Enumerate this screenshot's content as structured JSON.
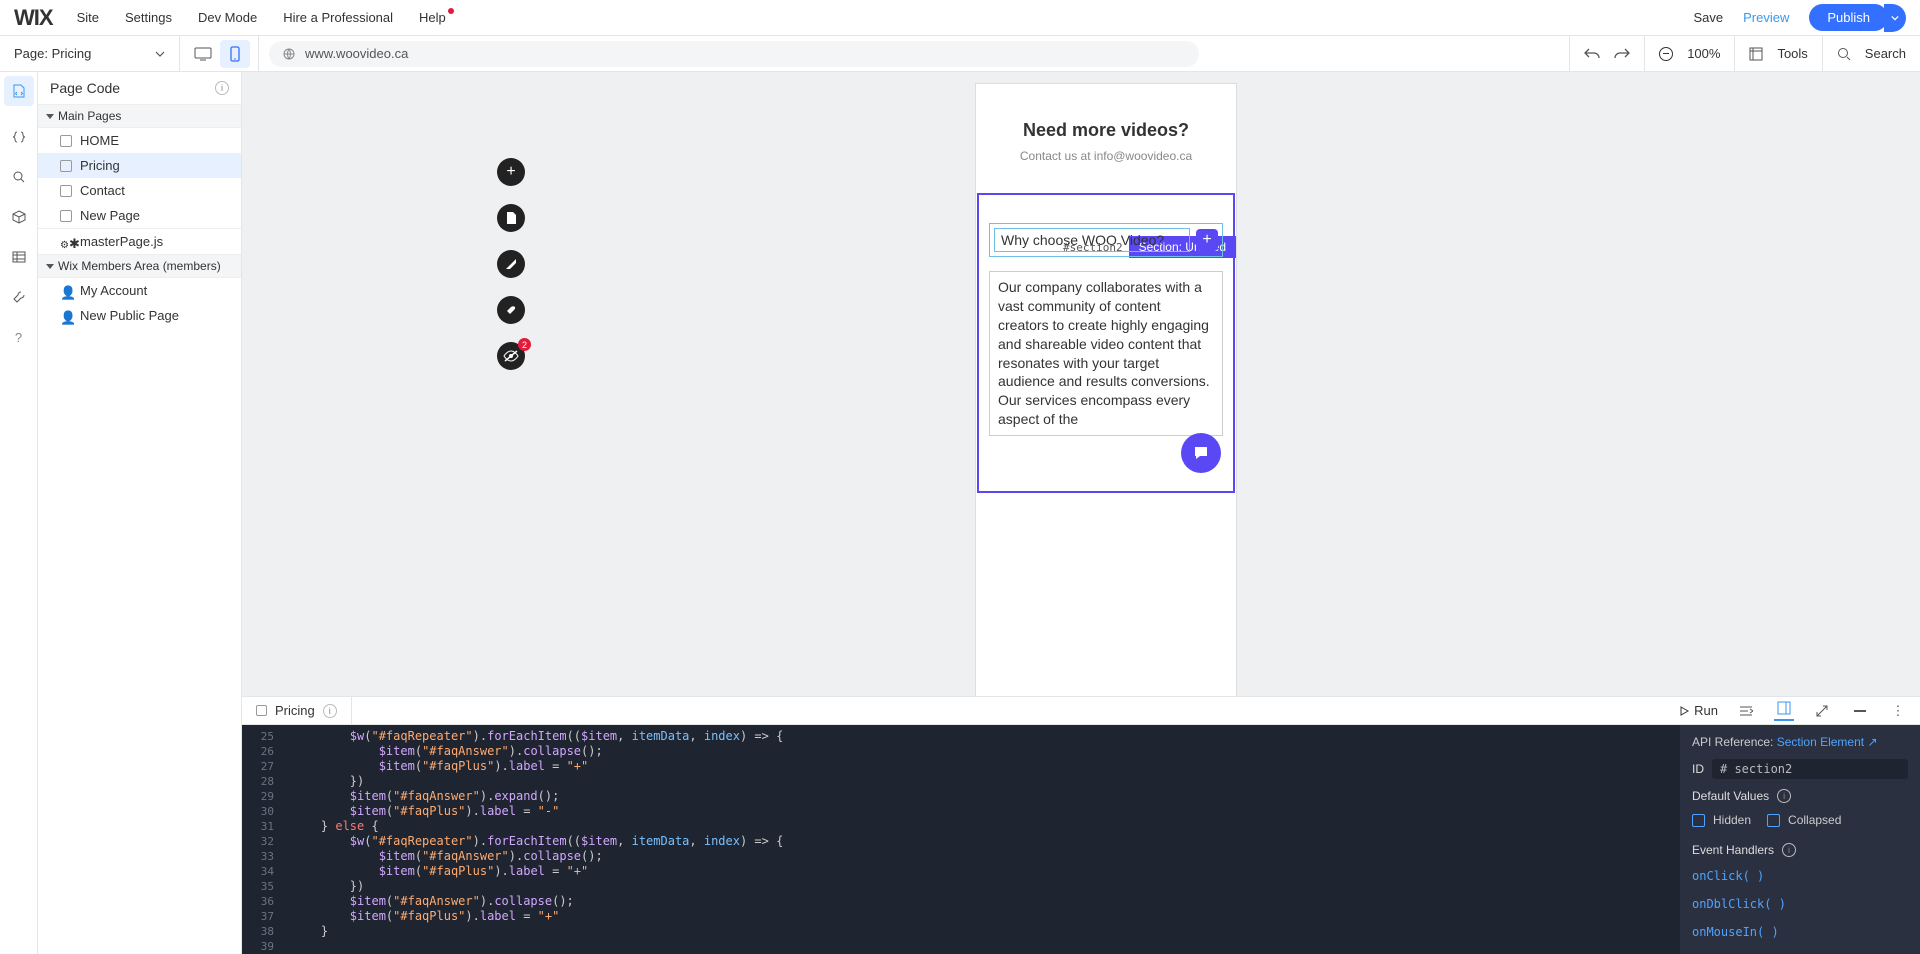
{
  "topMenu": {
    "logo": "WIX",
    "items": [
      "Site",
      "Settings",
      "Dev Mode",
      "Hire a Professional",
      "Help"
    ],
    "save": "Save",
    "preview": "Preview",
    "publish": "Publish"
  },
  "secondBar": {
    "pageLabel": "Page: Pricing",
    "url": "www.woovideo.ca",
    "zoom": "100%",
    "tools": "Tools",
    "search": "Search"
  },
  "pagePanel": {
    "title": "Page Code",
    "groups": [
      {
        "label": "Main Pages",
        "items": [
          "HOME",
          "Pricing",
          "Contact",
          "New Page"
        ],
        "extra": "masterPage.js",
        "selectedIndex": 1
      },
      {
        "label": "Wix Members Area (members)",
        "items": [
          "My Account",
          "New Public Page"
        ]
      }
    ]
  },
  "canvas": {
    "heroTitle": "Need more videos?",
    "heroSub": "Contact us at info@woovideo.ca",
    "sectionId": "#section2",
    "sectionTag": "Section: Untitled",
    "faqQuestion": "Why choose WOO Video?",
    "faqAnswer": "Our company collaborates with a vast community of content creators to create highly engaging and shareable video content that resonates with your target audience and results conversions. Our services encompass every aspect of the"
  },
  "codePanel": {
    "tab": "Pricing",
    "run": "Run",
    "gutterStart": 25,
    "lines": [
      "        $w(\"#faqRepeater\").forEachItem(($item, itemData, index) => {",
      "            $item(\"#faqAnswer\").collapse();",
      "            $item(\"#faqPlus\").label = \"+\"",
      "        })",
      "        $item(\"#faqAnswer\").expand();",
      "        $item(\"#faqPlus\").label = \"-\"",
      "    } else {",
      "        $w(\"#faqRepeater\").forEachItem(($item, itemData, index) => {",
      "            $item(\"#faqAnswer\").collapse();",
      "            $item(\"#faqPlus\").label = \"+\"",
      "        })",
      "        $item(\"#faqAnswer\").collapse();",
      "        $item(\"#faqPlus\").label = \"+\"",
      "    }",
      ""
    ]
  },
  "props": {
    "apiRefLabel": "API Reference:",
    "apiRefLink": "Section Element",
    "idLabel": "ID",
    "idValue": "# section2",
    "defaultValues": "Default Values",
    "hidden": "Hidden",
    "collapsed": "Collapsed",
    "eventHandlers": "Event Handlers",
    "handlers": [
      "onClick( )",
      "onDblClick( )",
      "onMouseIn( )"
    ]
  }
}
